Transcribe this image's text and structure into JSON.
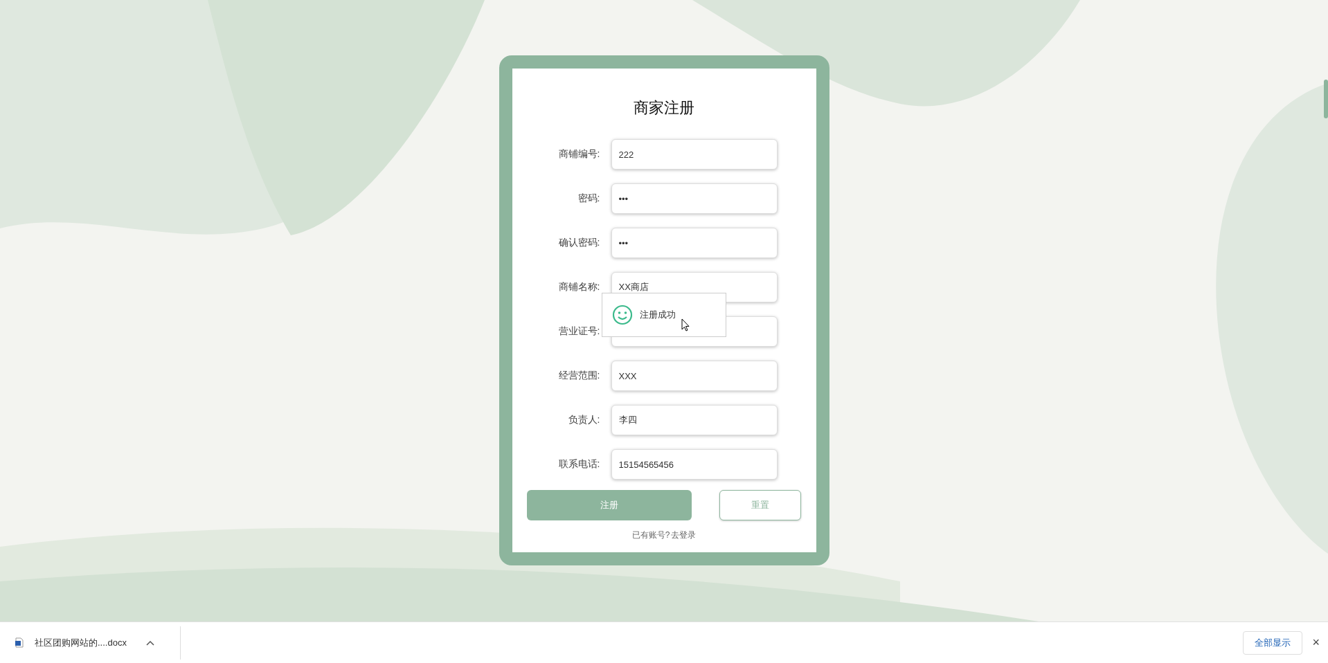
{
  "form": {
    "title": "商家注册",
    "fields": [
      {
        "label": "商铺编号:",
        "value": "222"
      },
      {
        "label": "密码:",
        "value": "•••"
      },
      {
        "label": "确认密码:",
        "value": "•••"
      },
      {
        "label": "商铺名称:",
        "value": "XX商店"
      },
      {
        "label": "营业证号:"
      },
      {
        "label": "经营范围:",
        "value": "XXX"
      },
      {
        "label": "负责人:",
        "value": "李四"
      },
      {
        "label": "联系电话:",
        "value": "15154565456"
      }
    ],
    "buttons": [
      {
        "label": "注册",
        "kind": "primary"
      },
      {
        "label": "重置",
        "kind": "secondary"
      }
    ],
    "login_prompt": "已有账号?",
    "login_link": "去登录"
  },
  "toast": {
    "message": "注册成功"
  },
  "download_bar": {
    "file": "社区团购网站的....docx",
    "show_all": "全部显示",
    "close": "×"
  }
}
